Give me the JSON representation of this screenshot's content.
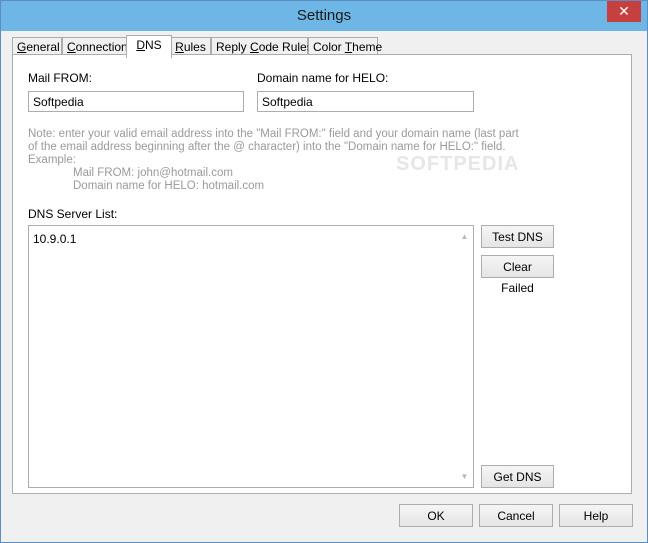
{
  "window": {
    "title": "Settings",
    "close_glyph": "✕"
  },
  "tabs": [
    {
      "label": "General",
      "underline": "G",
      "rest": "eneral"
    },
    {
      "label": "Connection",
      "underline": "C",
      "rest": "onnection"
    },
    {
      "label": "DNS",
      "underline": "D",
      "rest": "NS"
    },
    {
      "label": "Rules",
      "underline": "R",
      "rest": "ules"
    },
    {
      "label": "Reply Code Rules",
      "pre": "Reply ",
      "underline": "C",
      "rest": "ode Rules"
    },
    {
      "label": "Color Theme",
      "pre": "Color ",
      "underline": "T",
      "rest": "heme"
    }
  ],
  "active_tab": "DNS",
  "dns": {
    "mail_from_label": "Mail FROM:",
    "mail_from_value": "Softpedia",
    "domain_label": "Domain name for HELO:",
    "domain_value": "Softpedia",
    "note_line1": "Note: enter your valid email address into the \"Mail FROM:\" field and your domain name (last part",
    "note_line2": "of the email address beginning after the @ character) into the \"Domain name for HELO:\" field.",
    "note_line3": "Example:",
    "note_example1": "Mail FROM: john@hotmail.com",
    "note_example2": "Domain name for HELO: hotmail.com",
    "server_list_label": "DNS Server List:",
    "servers": [
      "10.9.0.1"
    ],
    "test_dns_label": "Test DNS",
    "clear_failed_label": "Clear Failed",
    "get_dns_label": "Get DNS",
    "watermark": "SOFTPEDIA"
  },
  "footer": {
    "ok_label": "OK",
    "cancel_label": "Cancel",
    "help_label": "Help"
  }
}
